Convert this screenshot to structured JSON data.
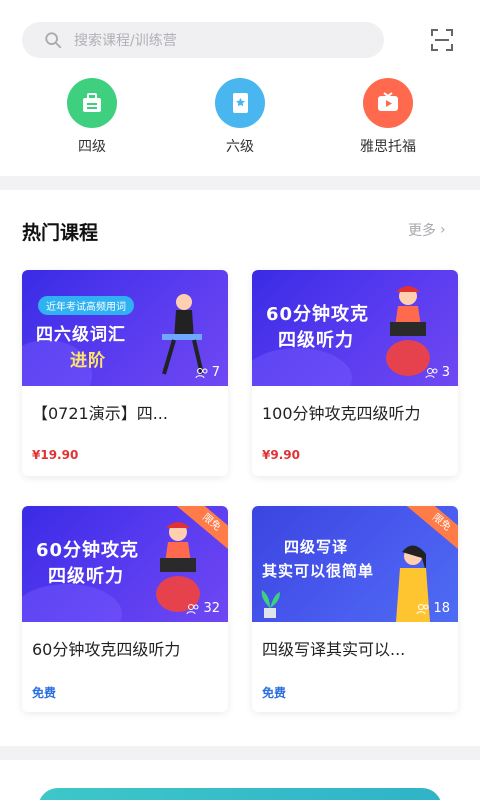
{
  "search": {
    "placeholder": "搜索课程/训练营"
  },
  "categories": [
    {
      "label": "四级",
      "color": "#3ecf7f",
      "icon": "briefcase-icon"
    },
    {
      "label": "六级",
      "color": "#49b6ef",
      "icon": "certificate-icon"
    },
    {
      "label": "雅思托福",
      "color": "#ff6a4f",
      "icon": "tv-play-icon"
    }
  ],
  "hot": {
    "title": "热门课程",
    "more": "更多"
  },
  "courses": [
    {
      "thumb_small": "近年考试高频用词",
      "thumb_line1": "四六级词汇",
      "thumb_line2": "进阶",
      "count": "7",
      "badge": "",
      "title": "【0721演示】四...",
      "price": "¥19.90",
      "free": false
    },
    {
      "thumb_small": "",
      "thumb_line1": "60分钟攻克",
      "thumb_line2": "四级听力",
      "count": "3",
      "badge": "",
      "title": "100分钟攻克四级听力",
      "price": "¥9.90",
      "free": false
    },
    {
      "thumb_small": "",
      "thumb_line1": "60分钟攻克",
      "thumb_line2": "四级听力",
      "count": "32",
      "badge": "限免",
      "title": "60分钟攻克四级听力",
      "price": "免费",
      "free": true
    },
    {
      "thumb_small": "",
      "thumb_line1": "四级写译",
      "thumb_line2": "其实可以很简单",
      "count": "18",
      "badge": "限免",
      "title": "四级写译其实可以...",
      "price": "免费",
      "free": true
    }
  ]
}
